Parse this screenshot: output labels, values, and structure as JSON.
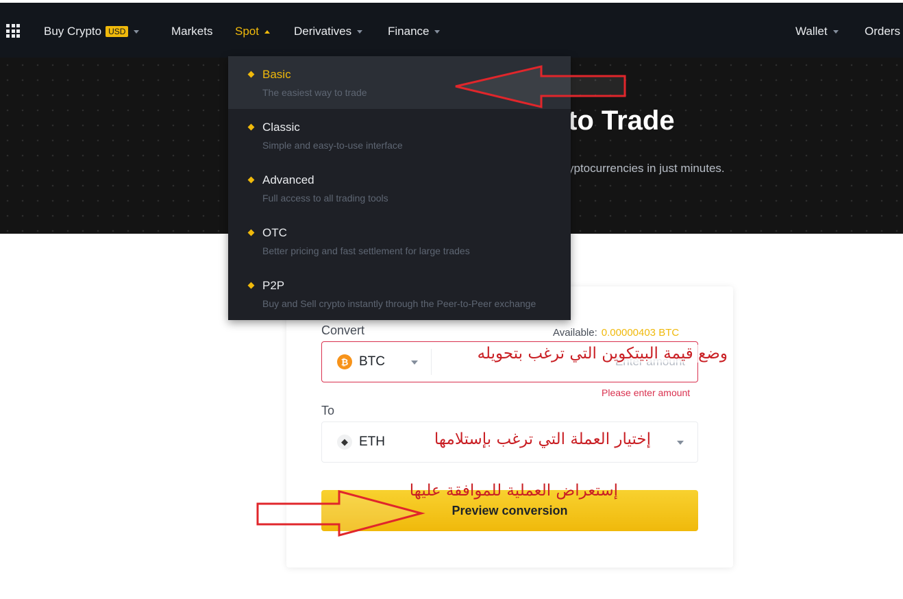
{
  "navbar": {
    "apps_icon": "apps-grid-icon",
    "items": [
      {
        "label": "Buy Crypto",
        "badge": "USD"
      },
      {
        "label": "Markets"
      },
      {
        "label": "Spot"
      },
      {
        "label": "Derivatives"
      },
      {
        "label": "Finance"
      },
      {
        "label": "Wallet"
      },
      {
        "label": "Orders"
      }
    ]
  },
  "hero": {
    "title": "to Trade",
    "subtitle": "yptocurrencies in just minutes."
  },
  "spot_menu": {
    "items": [
      {
        "title": "Basic",
        "desc": "The easiest way to trade",
        "active": true
      },
      {
        "title": "Classic",
        "desc": "Simple and easy-to-use interface"
      },
      {
        "title": "Advanced",
        "desc": "Full access to all trading tools"
      },
      {
        "title": "OTC",
        "desc": "Better pricing and fast settlement for large trades"
      },
      {
        "title": "P2P",
        "desc": "Buy and Sell crypto instantly through the Peer-to-Peer exchange"
      }
    ]
  },
  "convert": {
    "convert_label": "Convert",
    "available_label": "Available:",
    "available_value": "0.00000403 BTC",
    "from_coin": "BTC",
    "amount_placeholder": "Enter amount",
    "error": "Please enter amount",
    "to_label": "To",
    "to_coin": "ETH",
    "preview_button": "Preview conversion"
  },
  "annotations": {
    "enter_amount": "وضع قيمة البيتكوين التي ترغب بتحويله",
    "choose_currency": "إختيار العملة التي ترغب بإستلامها",
    "review": "إستعراض العملية للموافقة عليها"
  },
  "colors": {
    "accent": "#f0b90b",
    "navbar_bg": "#12161c",
    "menu_bg": "#1e2026",
    "error": "#d9304e",
    "annotation": "#c91f24"
  }
}
